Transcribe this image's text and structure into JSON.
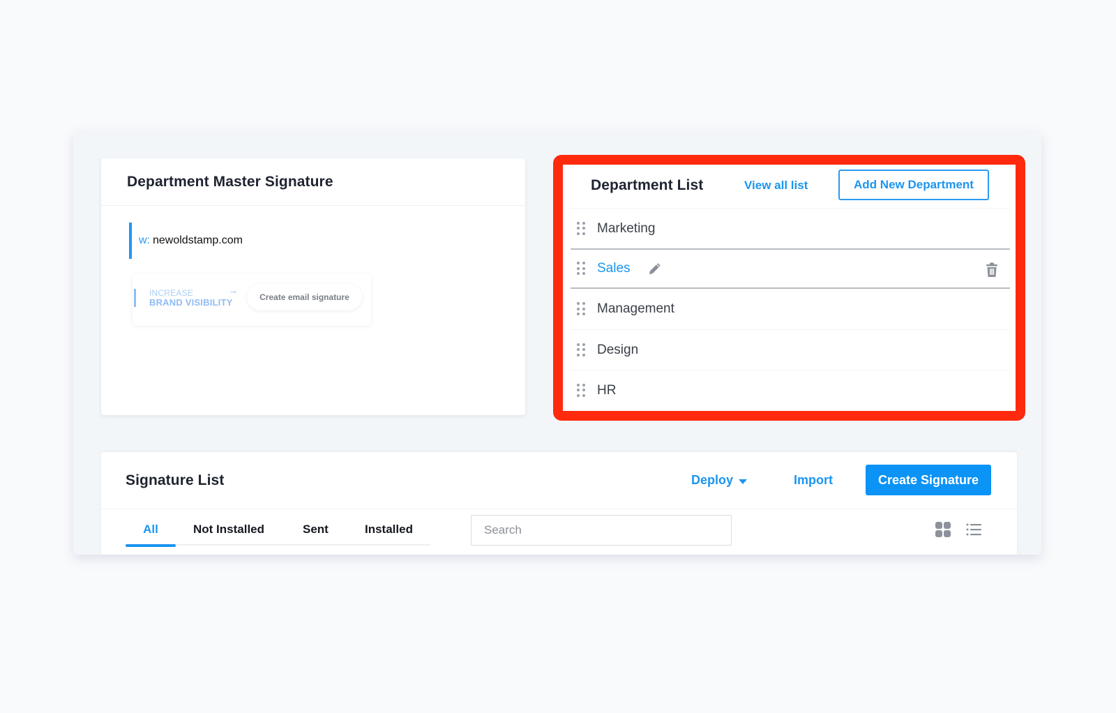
{
  "master_signature": {
    "title": "Department Master Signature",
    "web_label": "w:",
    "web_value": "newoldstamp.com",
    "banner": {
      "line1": "INCREASE",
      "line2": "BRAND VISIBILITY",
      "arrow": "→",
      "button": "Create email signature"
    }
  },
  "department_list": {
    "title": "Department List",
    "view_all": "View all list",
    "add_button": "Add New Department",
    "items": [
      {
        "name": "Marketing",
        "active": false
      },
      {
        "name": "Sales",
        "active": true
      },
      {
        "name": "Management",
        "active": false
      },
      {
        "name": "Design",
        "active": false
      },
      {
        "name": "HR",
        "active": false
      }
    ]
  },
  "signature_list": {
    "title": "Signature List",
    "deploy": "Deploy",
    "import": "Import",
    "create": "Create Signature",
    "tabs": [
      {
        "label": "All",
        "active": true
      },
      {
        "label": "Not Installed",
        "active": false
      },
      {
        "label": "Sent",
        "active": false
      },
      {
        "label": "Installed",
        "active": false
      }
    ],
    "search_placeholder": "Search",
    "view_icons": [
      "grid-view-icon",
      "list-view-icon"
    ]
  },
  "colors": {
    "accent": "#1b95ef",
    "highlight": "#ff2a0d",
    "primary_button": "#0b93f6"
  }
}
